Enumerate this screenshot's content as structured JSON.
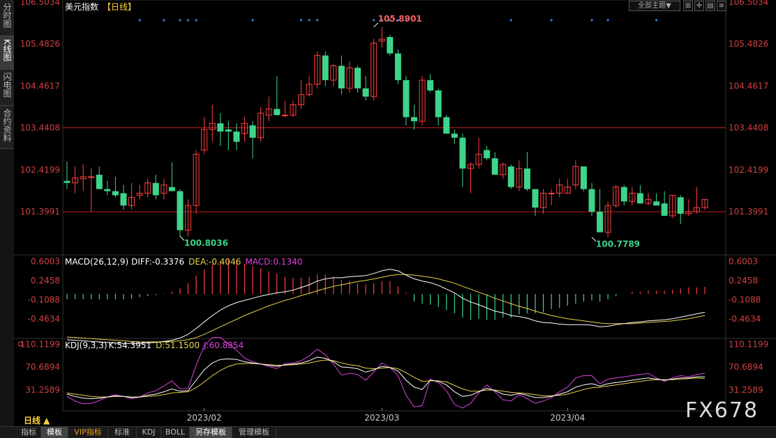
{
  "side_tabs": [
    {
      "label": "分时图",
      "active": false
    },
    {
      "label": "K线图",
      "active": true
    },
    {
      "label": "闪电图",
      "active": false
    },
    {
      "label": "合约资料",
      "active": false
    }
  ],
  "top_controls": {
    "theme_label": "全部主题▼",
    "icons": [
      "grid-icon",
      "crosshair-icon",
      "stack-icon",
      "menu-icon"
    ]
  },
  "bottom_tabs": [
    {
      "label": "指标",
      "active": false
    },
    {
      "label": "模板",
      "active": true
    },
    {
      "label": "VIP指标",
      "active": false,
      "vip": true
    },
    {
      "label": "标准",
      "active": false
    },
    {
      "label": "KDJ",
      "active": false
    },
    {
      "label": "BOLL",
      "active": false
    },
    {
      "label": "另存模板",
      "active": true
    },
    {
      "label": "管理模板",
      "active": false
    }
  ],
  "period_label": "日线 ▲",
  "watermark": "FX678",
  "colors": {
    "up": "#ff4040",
    "down": "#3ed48a",
    "white": "#ffffff",
    "yellow": "#e6d34a",
    "magenta": "#e040e0",
    "dot": "#3a7fd0",
    "bg": "#000000"
  },
  "chart_data": [
    {
      "type": "candlestick",
      "title": "美元指数",
      "period_tag": "【日线】",
      "y_ticks": [
        "106.5034",
        "105.4826",
        "104.4617",
        "103.4408",
        "102.4199",
        "101.3991"
      ],
      "ylim": [
        100.35,
        106.55
      ],
      "hlines": [
        103.4408,
        101.3991
      ],
      "x_ticks": [
        {
          "label": "2023/02",
          "index": 17
        },
        {
          "label": "2023/03",
          "index": 39
        },
        {
          "label": "2023/04",
          "index": 62
        }
      ],
      "annotations": [
        {
          "text": "105.8901",
          "index": 38,
          "value": 105.8901,
          "color": "#ff6060"
        },
        {
          "text": "100.8036",
          "index": 14,
          "value": 100.8036,
          "color": "#3ed48a"
        },
        {
          "text": "100.7789",
          "index": 65,
          "value": 100.7789,
          "color": "#3ed48a"
        }
      ],
      "dot_indices": [
        9,
        12,
        14,
        15,
        16,
        23,
        29,
        30,
        31,
        38,
        39,
        40,
        41,
        42,
        55,
        60,
        65,
        67,
        73
      ],
      "candles": [
        {
          "o": 102.15,
          "h": 102.62,
          "l": 101.95,
          "c": 102.1
        },
        {
          "o": 102.1,
          "h": 102.5,
          "l": 101.85,
          "c": 102.22
        },
        {
          "o": 102.2,
          "h": 102.55,
          "l": 101.9,
          "c": 102.25
        },
        {
          "o": 102.25,
          "h": 102.45,
          "l": 101.4,
          "c": 102.25
        },
        {
          "o": 102.3,
          "h": 102.5,
          "l": 101.95,
          "c": 101.95
        },
        {
          "o": 101.95,
          "h": 102.15,
          "l": 101.8,
          "c": 101.9
        },
        {
          "o": 101.9,
          "h": 102.25,
          "l": 101.75,
          "c": 101.8
        },
        {
          "o": 101.85,
          "h": 102.05,
          "l": 101.45,
          "c": 101.55
        },
        {
          "o": 101.55,
          "h": 102.1,
          "l": 101.45,
          "c": 101.75
        },
        {
          "o": 101.8,
          "h": 102.05,
          "l": 101.7,
          "c": 101.85
        },
        {
          "o": 101.85,
          "h": 102.2,
          "l": 101.75,
          "c": 102.1
        },
        {
          "o": 102.1,
          "h": 102.3,
          "l": 101.7,
          "c": 101.8
        },
        {
          "o": 101.85,
          "h": 102.2,
          "l": 101.7,
          "c": 102.05
        },
        {
          "o": 102.0,
          "h": 102.6,
          "l": 101.9,
          "c": 101.9
        },
        {
          "o": 101.9,
          "h": 101.95,
          "l": 100.8,
          "c": 100.95
        },
        {
          "o": 100.95,
          "h": 101.7,
          "l": 100.8,
          "c": 101.55
        },
        {
          "o": 101.55,
          "h": 102.9,
          "l": 101.35,
          "c": 102.8
        },
        {
          "o": 102.9,
          "h": 103.7,
          "l": 102.8,
          "c": 103.4
        },
        {
          "o": 103.4,
          "h": 104.0,
          "l": 103.1,
          "c": 103.55
        },
        {
          "o": 103.55,
          "h": 103.8,
          "l": 103.0,
          "c": 103.35
        },
        {
          "o": 103.4,
          "h": 103.6,
          "l": 102.9,
          "c": 103.35
        },
        {
          "o": 103.35,
          "h": 103.55,
          "l": 102.9,
          "c": 103.1
        },
        {
          "o": 103.3,
          "h": 103.7,
          "l": 103.1,
          "c": 103.55
        },
        {
          "o": 103.5,
          "h": 103.6,
          "l": 102.7,
          "c": 103.2
        },
        {
          "o": 103.2,
          "h": 103.95,
          "l": 103.1,
          "c": 103.8
        },
        {
          "o": 103.75,
          "h": 104.2,
          "l": 103.6,
          "c": 103.9
        },
        {
          "o": 103.9,
          "h": 104.7,
          "l": 103.8,
          "c": 103.75
        },
        {
          "o": 103.75,
          "h": 104.1,
          "l": 103.7,
          "c": 103.75
        },
        {
          "o": 103.75,
          "h": 104.1,
          "l": 103.7,
          "c": 104.0
        },
        {
          "o": 104.0,
          "h": 104.6,
          "l": 103.9,
          "c": 104.25
        },
        {
          "o": 104.25,
          "h": 104.7,
          "l": 104.2,
          "c": 104.5
        },
        {
          "o": 104.5,
          "h": 105.3,
          "l": 104.4,
          "c": 105.2
        },
        {
          "o": 105.2,
          "h": 105.3,
          "l": 104.45,
          "c": 104.6
        },
        {
          "o": 104.6,
          "h": 105.0,
          "l": 104.45,
          "c": 104.95
        },
        {
          "o": 104.95,
          "h": 105.2,
          "l": 104.25,
          "c": 104.4
        },
        {
          "o": 104.4,
          "h": 105.05,
          "l": 104.3,
          "c": 104.9
        },
        {
          "o": 104.9,
          "h": 104.95,
          "l": 104.3,
          "c": 104.4
        },
        {
          "o": 104.4,
          "h": 104.7,
          "l": 104.1,
          "c": 104.2
        },
        {
          "o": 104.2,
          "h": 105.6,
          "l": 104.1,
          "c": 105.5
        },
        {
          "o": 105.55,
          "h": 105.89,
          "l": 105.4,
          "c": 105.6
        },
        {
          "o": 105.65,
          "h": 105.7,
          "l": 105.2,
          "c": 105.25
        },
        {
          "o": 105.25,
          "h": 105.35,
          "l": 104.5,
          "c": 104.6
        },
        {
          "o": 104.6,
          "h": 104.7,
          "l": 103.5,
          "c": 103.7
        },
        {
          "o": 103.7,
          "h": 104.0,
          "l": 103.4,
          "c": 103.6
        },
        {
          "o": 103.6,
          "h": 104.7,
          "l": 103.5,
          "c": 104.6
        },
        {
          "o": 104.6,
          "h": 104.75,
          "l": 104.3,
          "c": 104.35
        },
        {
          "o": 104.35,
          "h": 104.4,
          "l": 103.5,
          "c": 103.7
        },
        {
          "o": 103.7,
          "h": 103.75,
          "l": 103.3,
          "c": 103.3
        },
        {
          "o": 103.3,
          "h": 103.4,
          "l": 103.05,
          "c": 103.2
        },
        {
          "o": 103.2,
          "h": 103.3,
          "l": 102.0,
          "c": 102.45
        },
        {
          "o": 102.45,
          "h": 102.6,
          "l": 101.85,
          "c": 102.55
        },
        {
          "o": 102.55,
          "h": 103.2,
          "l": 102.45,
          "c": 102.8
        },
        {
          "o": 102.9,
          "h": 103.0,
          "l": 102.65,
          "c": 102.7
        },
        {
          "o": 102.7,
          "h": 102.85,
          "l": 102.3,
          "c": 102.3
        },
        {
          "o": 102.3,
          "h": 102.6,
          "l": 102.2,
          "c": 102.55
        },
        {
          "o": 102.5,
          "h": 102.55,
          "l": 101.95,
          "c": 102.0
        },
        {
          "o": 102.0,
          "h": 102.65,
          "l": 101.9,
          "c": 102.45
        },
        {
          "o": 102.45,
          "h": 102.85,
          "l": 101.9,
          "c": 101.95
        },
        {
          "o": 101.95,
          "h": 101.95,
          "l": 101.3,
          "c": 101.5
        },
        {
          "o": 101.5,
          "h": 101.95,
          "l": 101.35,
          "c": 101.85
        },
        {
          "o": 101.85,
          "h": 101.95,
          "l": 101.55,
          "c": 101.85
        },
        {
          "o": 101.85,
          "h": 102.2,
          "l": 101.75,
          "c": 102.05
        },
        {
          "o": 101.85,
          "h": 102.2,
          "l": 101.85,
          "c": 102.0
        },
        {
          "o": 102.05,
          "h": 102.65,
          "l": 101.95,
          "c": 102.5
        },
        {
          "o": 102.5,
          "h": 102.5,
          "l": 101.9,
          "c": 101.95
        },
        {
          "o": 101.95,
          "h": 102.1,
          "l": 101.3,
          "c": 101.4
        },
        {
          "o": 101.4,
          "h": 101.95,
          "l": 100.9,
          "c": 100.9
        },
        {
          "o": 100.9,
          "h": 101.65,
          "l": 100.78,
          "c": 101.55
        },
        {
          "o": 101.55,
          "h": 102.05,
          "l": 101.5,
          "c": 102.0
        },
        {
          "o": 102.0,
          "h": 102.05,
          "l": 101.55,
          "c": 101.65
        },
        {
          "o": 101.65,
          "h": 102.0,
          "l": 101.55,
          "c": 101.85
        },
        {
          "o": 101.85,
          "h": 102.05,
          "l": 101.6,
          "c": 101.6
        },
        {
          "o": 101.6,
          "h": 101.85,
          "l": 101.55,
          "c": 101.7
        },
        {
          "o": 101.65,
          "h": 101.85,
          "l": 101.55,
          "c": 101.55
        },
        {
          "o": 101.6,
          "h": 101.9,
          "l": 101.3,
          "c": 101.3
        },
        {
          "o": 101.3,
          "h": 101.8,
          "l": 101.25,
          "c": 101.8
        },
        {
          "o": 101.75,
          "h": 101.8,
          "l": 101.1,
          "c": 101.35
        },
        {
          "o": 101.35,
          "h": 101.7,
          "l": 101.3,
          "c": 101.4
        },
        {
          "o": 101.4,
          "h": 102.0,
          "l": 101.35,
          "c": 101.5
        },
        {
          "o": 101.5,
          "h": 101.7,
          "l": 101.45,
          "c": 101.7
        }
      ]
    },
    {
      "type": "bar",
      "title": "MACD(26,12,9)",
      "legend": [
        {
          "name": "DIFF",
          "value": "-0.3376",
          "color": "#ffffff"
        },
        {
          "name": "DEA",
          "value": "-0.4046",
          "color": "#e6d34a"
        },
        {
          "name": "MACD",
          "value": "0.1340",
          "color": "#e040e0"
        }
      ],
      "y_ticks": [
        "0.6003",
        "0.2458",
        "-0.1088",
        "-0.4634"
      ],
      "ylim": [
        -0.8,
        0.7
      ],
      "diff": [
        -0.85,
        -0.86,
        -0.87,
        -0.88,
        -0.89,
        -0.9,
        -0.91,
        -0.92,
        -0.92,
        -0.92,
        -0.91,
        -0.9,
        -0.88,
        -0.86,
        -0.82,
        -0.75,
        -0.64,
        -0.52,
        -0.4,
        -0.3,
        -0.22,
        -0.16,
        -0.12,
        -0.08,
        -0.04,
        -0.01,
        0.02,
        0.04,
        0.07,
        0.12,
        0.17,
        0.24,
        0.28,
        0.3,
        0.3,
        0.32,
        0.33,
        0.34,
        0.38,
        0.43,
        0.46,
        0.43,
        0.35,
        0.28,
        0.24,
        0.21,
        0.16,
        0.09,
        0.02,
        -0.08,
        -0.15,
        -0.2,
        -0.26,
        -0.32,
        -0.35,
        -0.4,
        -0.42,
        -0.45,
        -0.5,
        -0.53,
        -0.54,
        -0.56,
        -0.57,
        -0.57,
        -0.57,
        -0.58,
        -0.61,
        -0.6,
        -0.57,
        -0.55,
        -0.53,
        -0.52,
        -0.5,
        -0.49,
        -0.48,
        -0.46,
        -0.43,
        -0.4,
        -0.37,
        -0.34
      ],
      "dea": [
        -0.8,
        -0.81,
        -0.82,
        -0.83,
        -0.84,
        -0.85,
        -0.86,
        -0.87,
        -0.88,
        -0.89,
        -0.89,
        -0.89,
        -0.89,
        -0.88,
        -0.87,
        -0.85,
        -0.81,
        -0.75,
        -0.68,
        -0.61,
        -0.54,
        -0.47,
        -0.4,
        -0.34,
        -0.28,
        -0.22,
        -0.17,
        -0.12,
        -0.08,
        -0.03,
        0.01,
        0.06,
        0.1,
        0.14,
        0.17,
        0.2,
        0.23,
        0.25,
        0.28,
        0.31,
        0.34,
        0.36,
        0.36,
        0.35,
        0.33,
        0.31,
        0.28,
        0.24,
        0.2,
        0.14,
        0.09,
        0.03,
        -0.02,
        -0.08,
        -0.13,
        -0.18,
        -0.23,
        -0.27,
        -0.32,
        -0.36,
        -0.4,
        -0.43,
        -0.46,
        -0.48,
        -0.5,
        -0.52,
        -0.54,
        -0.55,
        -0.55,
        -0.55,
        -0.55,
        -0.54,
        -0.53,
        -0.52,
        -0.51,
        -0.5,
        -0.48,
        -0.46,
        -0.43,
        -0.4
      ],
      "macd": [
        -0.1,
        -0.1,
        -0.1,
        -0.1,
        -0.1,
        -0.1,
        -0.1,
        -0.1,
        -0.09,
        -0.06,
        -0.04,
        -0.02,
        0.01,
        0.04,
        0.1,
        0.2,
        0.34,
        0.46,
        0.56,
        0.62,
        0.64,
        0.62,
        0.56,
        0.52,
        0.48,
        0.42,
        0.38,
        0.32,
        0.3,
        0.3,
        0.32,
        0.36,
        0.36,
        0.32,
        0.26,
        0.24,
        0.2,
        0.18,
        0.2,
        0.24,
        0.24,
        0.14,
        0.02,
        -0.14,
        -0.18,
        -0.2,
        -0.24,
        -0.3,
        -0.36,
        -0.44,
        -0.48,
        -0.46,
        -0.48,
        -0.48,
        -0.44,
        -0.44,
        -0.38,
        -0.36,
        -0.36,
        -0.34,
        -0.28,
        -0.26,
        -0.22,
        -0.18,
        -0.14,
        -0.12,
        -0.14,
        -0.1,
        -0.04,
        0.0,
        0.04,
        0.04,
        0.06,
        0.06,
        0.06,
        0.08,
        0.1,
        0.12,
        0.12,
        0.13
      ]
    },
    {
      "type": "line",
      "title": "KDJ(9,3,3)",
      "legend": [
        {
          "name": "K",
          "value": "54.3951",
          "color": "#ffffff"
        },
        {
          "name": "D",
          "value": "51.1500",
          "color": "#e6d34a"
        },
        {
          "name": "J",
          "value": "60.8854",
          "color": "#e040e0"
        }
      ],
      "y_ticks": [
        "110.1199",
        "70.6894",
        "31.2589"
      ],
      "ylim": [
        -5,
        118
      ],
      "k": [
        24,
        20,
        17,
        16,
        17,
        19,
        21,
        20,
        18,
        19,
        22,
        24,
        28,
        33,
        29,
        30,
        48,
        66,
        78,
        84,
        85,
        84,
        80,
        78,
        76,
        74,
        72,
        75,
        76,
        78,
        82,
        88,
        86,
        80,
        71,
        70,
        68,
        62,
        66,
        72,
        70,
        64,
        48,
        36,
        32,
        48,
        46,
        40,
        28,
        20,
        22,
        28,
        34,
        30,
        24,
        22,
        25,
        22,
        18,
        18,
        20,
        24,
        28,
        36,
        40,
        42,
        38,
        42,
        44,
        46,
        48,
        50,
        52,
        50,
        48,
        50,
        52,
        52,
        54,
        54
      ],
      "d": [
        26,
        24,
        22,
        20,
        19,
        19,
        20,
        20,
        19,
        19,
        20,
        21,
        23,
        26,
        27,
        28,
        35,
        45,
        56,
        65,
        72,
        76,
        77,
        77,
        76,
        75,
        74,
        74,
        75,
        76,
        78,
        81,
        83,
        82,
        78,
        75,
        73,
        69,
        68,
        69,
        70,
        68,
        61,
        53,
        46,
        47,
        47,
        45,
        39,
        33,
        29,
        29,
        31,
        31,
        29,
        27,
        26,
        25,
        23,
        21,
        21,
        22,
        24,
        28,
        32,
        35,
        36,
        38,
        40,
        42,
        44,
        46,
        48,
        49,
        49,
        49,
        50,
        51,
        52,
        51
      ],
      "j": [
        20,
        12,
        7,
        8,
        13,
        19,
        23,
        20,
        16,
        19,
        26,
        30,
        38,
        47,
        33,
        34,
        74,
        108,
        122,
        122,
        111,
        100,
        86,
        80,
        76,
        72,
        68,
        77,
        78,
        82,
        90,
        102,
        92,
        76,
        57,
        60,
        58,
        48,
        62,
        78,
        70,
        56,
        22,
        2,
        4,
        50,
        44,
        30,
        6,
        0,
        8,
        26,
        40,
        28,
        14,
        12,
        23,
        16,
        8,
        12,
        18,
        28,
        36,
        52,
        56,
        56,
        42,
        50,
        52,
        54,
        56,
        58,
        60,
        52,
        46,
        52,
        56,
        54,
        58,
        60
      ]
    }
  ]
}
